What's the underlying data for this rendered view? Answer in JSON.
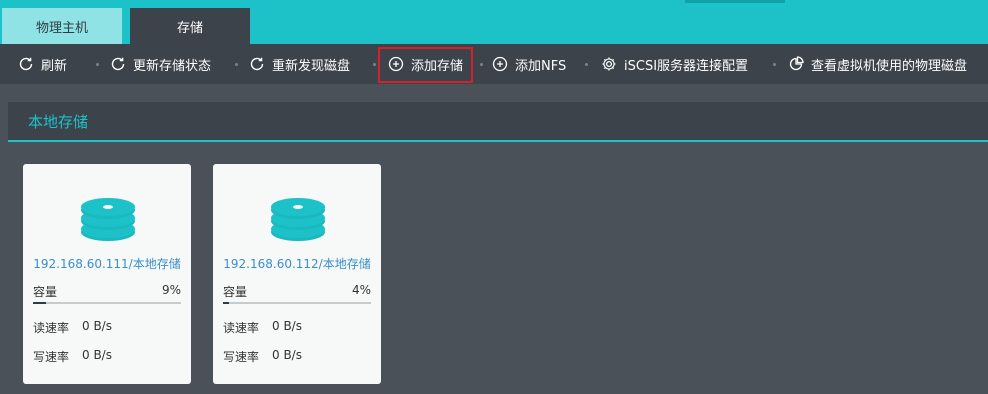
{
  "tabs": [
    {
      "label": "物理主机"
    },
    {
      "label": "存储"
    }
  ],
  "toolbar": {
    "items": [
      {
        "label": "刷新",
        "icon": "refresh-icon"
      },
      {
        "label": "更新存储状态",
        "icon": "refresh-icon"
      },
      {
        "label": "重新发现磁盘",
        "icon": "refresh-icon"
      },
      {
        "label": "添加存储",
        "icon": "plus-circle-icon"
      },
      {
        "label": "添加NFS",
        "icon": "plus-circle-icon"
      },
      {
        "label": "iSCSI服务器连接配置",
        "icon": "gear-icon"
      },
      {
        "label": "查看虚拟机使用的物理磁盘",
        "icon": "pie-chart-icon"
      }
    ]
  },
  "panel": {
    "title": "本地存储"
  },
  "cards": [
    {
      "title": "192.168.60.111/本地存储",
      "capacity_label": "容量",
      "capacity_value": "9%",
      "capacity_fraction": 0.09,
      "read_label": "读速率",
      "read_value": "0 B/s",
      "write_label": "写速率",
      "write_value": "0 B/s"
    },
    {
      "title": "192.168.60.112/本地存储",
      "capacity_label": "容量",
      "capacity_value": "4%",
      "capacity_fraction": 0.04,
      "read_label": "读速率",
      "read_value": "0 B/s",
      "write_label": "写速率",
      "write_value": "0 B/s"
    }
  ],
  "colors": {
    "accent": "#1dc2c8",
    "toolbar_bg": "#3c434b",
    "page_bg": "#4b5159",
    "link": "#3a8fc8",
    "highlight": "#d3222a"
  }
}
